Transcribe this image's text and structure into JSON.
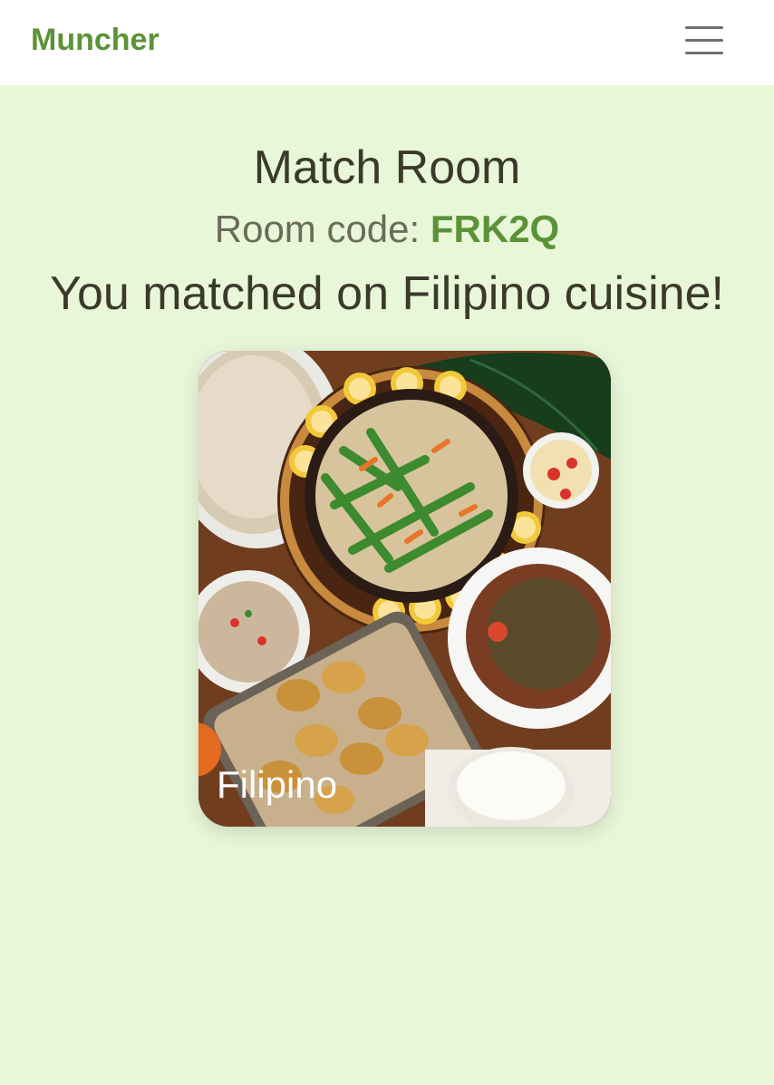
{
  "navbar": {
    "brand": "Muncher",
    "menu_icon": "hamburger-menu-icon"
  },
  "page": {
    "title": "Match Room",
    "room_code_label": "Room code:",
    "room_code": "FRK2Q",
    "match_message": "You matched on Filipino cuisine!"
  },
  "card": {
    "label": "Filipino",
    "image": "filipino-food-spread-photo"
  },
  "colors": {
    "background": "#e9f7d9",
    "brand": "#5b9337",
    "navbar": "#ffffff",
    "text": "#3b3a2a"
  }
}
